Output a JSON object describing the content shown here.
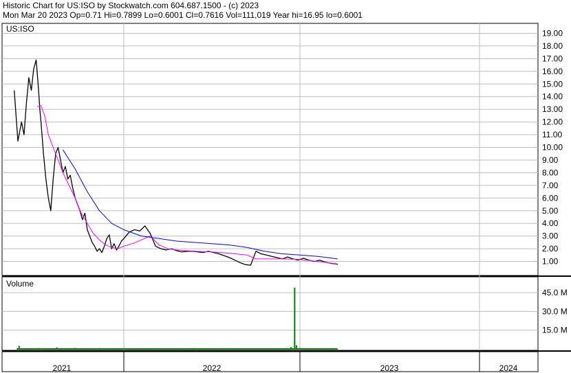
{
  "header": {
    "line1": "Historic Chart for US:ISO by Stockwatch.com 604.687.1500 - (c) 2023",
    "line2": "Mon Mar 20 2023   Op=0.71   Hi=0.7899   Lo=0.6001   Cl=0.7616   Vol=111,019   Year hi=16.95   lo=0.6001"
  },
  "chart_data": [
    {
      "type": "line",
      "title": "US:ISO",
      "ylabel": "",
      "ylim": [
        0,
        19.8
      ],
      "y_ticks": [
        "19.00",
        "18.00",
        "17.00",
        "16.00",
        "15.00",
        "14.00",
        "13.00",
        "12.00",
        "11.00",
        "10.00",
        "9.00",
        "8.00",
        "7.00",
        "6.00",
        "5.00",
        "4.00",
        "3.00",
        "2.00",
        "1.00"
      ],
      "grid": true,
      "x_categories": [
        "2021",
        "2022",
        "2023",
        "2024"
      ],
      "series": [
        {
          "name": "",
          "color": "#000000",
          "role": "price",
          "x": [
            2021.1,
            2021.13,
            2021.16,
            2021.18,
            2021.2,
            2021.22,
            2021.24,
            2021.26,
            2021.28,
            2021.3,
            2021.31,
            2021.32,
            2021.34,
            2021.36,
            2021.38,
            2021.4,
            2021.42,
            2021.44,
            2021.46,
            2021.48,
            2021.5,
            2021.52,
            2021.54,
            2021.56,
            2021.58,
            2021.6,
            2021.62,
            2021.64,
            2021.66,
            2021.68,
            2021.7,
            2021.72,
            2021.74,
            2021.76,
            2021.78,
            2021.8,
            2021.82,
            2021.84,
            2021.86,
            2021.88,
            2021.9,
            2021.92,
            2021.94,
            2021.96,
            2021.98,
            2022.0,
            2022.03,
            2022.06,
            2022.09,
            2022.12,
            2022.15,
            2022.18,
            2022.21,
            2022.24,
            2022.27,
            2022.3,
            2022.33,
            2022.36,
            2022.39,
            2022.42,
            2022.45,
            2022.48,
            2022.51,
            2022.54,
            2022.57,
            2022.6,
            2022.63,
            2022.66,
            2022.69,
            2022.72,
            2022.75,
            2022.78,
            2022.81,
            2022.84,
            2022.87,
            2022.9,
            2022.93,
            2022.96,
            2022.99,
            2023.02,
            2023.05,
            2023.08,
            2023.11,
            2023.14,
            2023.17,
            2023.2,
            2023.21
          ],
          "values": [
            14.5,
            10.5,
            12.0,
            11.0,
            13.5,
            15.5,
            14.5,
            16.2,
            16.9,
            14.5,
            13.0,
            12.0,
            9.5,
            7.5,
            6.0,
            5.0,
            7.5,
            9.5,
            10.0,
            9.0,
            8.0,
            8.5,
            7.5,
            7.8,
            6.8,
            6.0,
            5.5,
            5.0,
            4.3,
            4.8,
            3.5,
            3.0,
            2.5,
            2.2,
            1.8,
            2.0,
            1.7,
            2.2,
            2.8,
            3.1,
            2.0,
            2.4,
            1.9,
            2.2,
            2.6,
            2.8,
            3.3,
            3.5,
            3.4,
            3.8,
            3.2,
            2.2,
            2.0,
            1.9,
            2.0,
            1.85,
            1.75,
            1.8,
            1.8,
            1.75,
            1.7,
            1.8,
            1.7,
            1.6,
            1.45,
            1.3,
            1.1,
            0.9,
            0.75,
            0.7,
            1.8,
            1.6,
            1.5,
            1.4,
            1.3,
            1.2,
            1.35,
            1.2,
            1.1,
            1.25,
            1.1,
            1.0,
            1.1,
            0.95,
            0.85,
            0.8,
            0.76
          ]
        },
        {
          "name": "",
          "color": "#FF00FF",
          "role": "short moving average",
          "x": [
            2021.29,
            2021.32,
            2021.35,
            2021.38,
            2021.42,
            2021.46,
            2021.5,
            2021.55,
            2021.6,
            2021.65,
            2021.7,
            2021.75,
            2021.8,
            2021.85,
            2021.9,
            2021.95,
            2022.0,
            2022.05,
            2022.1,
            2022.15,
            2022.2,
            2022.25,
            2022.3,
            2022.4,
            2022.5,
            2022.6,
            2022.7,
            2022.75,
            2022.8,
            2022.9,
            2023.0,
            2023.1,
            2023.21
          ],
          "values": [
            13.2,
            13.3,
            12.5,
            11.0,
            10.0,
            9.0,
            8.0,
            7.0,
            6.0,
            4.8,
            4.0,
            3.2,
            2.7,
            2.3,
            2.1,
            2.0,
            2.2,
            2.4,
            2.7,
            3.0,
            2.3,
            2.0,
            1.9,
            1.8,
            1.75,
            1.65,
            1.5,
            1.2,
            1.2,
            1.2,
            1.15,
            1.0,
            0.8
          ]
        },
        {
          "name": "",
          "color": "#0000FF",
          "role": "long moving average",
          "x": [
            2021.5,
            2021.6,
            2021.7,
            2021.8,
            2021.9,
            2022.0,
            2022.1,
            2022.2,
            2022.3,
            2022.4,
            2022.5,
            2022.6,
            2022.7,
            2022.8,
            2022.9,
            2023.0,
            2023.1,
            2023.21
          ],
          "values": [
            9.8,
            8.3,
            6.5,
            5.0,
            4.0,
            3.5,
            3.0,
            2.8,
            2.6,
            2.5,
            2.4,
            2.3,
            2.1,
            1.8,
            1.6,
            1.5,
            1.4,
            1.2
          ]
        }
      ]
    },
    {
      "type": "bar",
      "title": "Volume",
      "ylim": [
        0,
        52
      ],
      "y_ticks": [
        "45.0 M",
        "30.0 M",
        "15.0 M"
      ],
      "grid": true,
      "color": "#008000",
      "x": [
        2021.14,
        2021.3,
        2021.45,
        2021.6,
        2021.8,
        2022.0,
        2022.2,
        2022.4,
        2022.6,
        2022.8,
        2022.95,
        2022.97,
        2022.98,
        2023.0,
        2023.1,
        2023.2
      ],
      "values": [
        2.5,
        0.8,
        1.2,
        0.8,
        0.7,
        0.6,
        0.6,
        0.7,
        0.6,
        0.5,
        1.5,
        49.0,
        3.0,
        0.8,
        0.6,
        0.5
      ]
    }
  ]
}
